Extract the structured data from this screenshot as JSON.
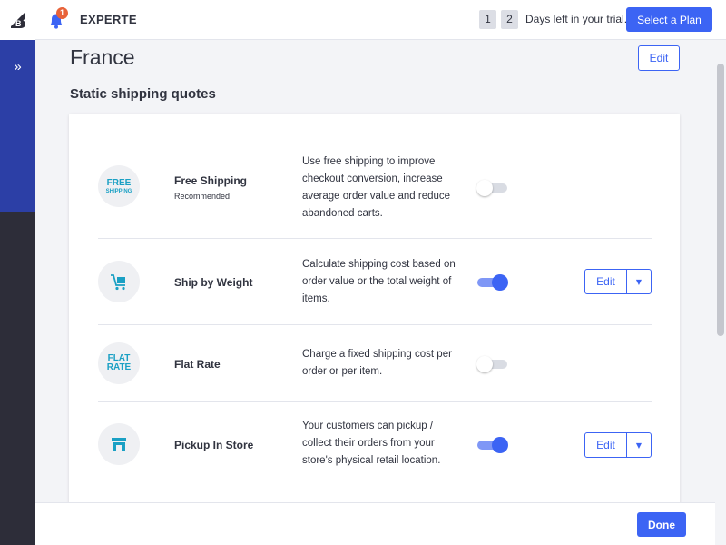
{
  "header": {
    "store_name": "EXPERTE",
    "notification_count": "1",
    "trial_digits": [
      "1",
      "2"
    ],
    "trial_text": "Days left in your trial.",
    "plan_button": "Select a Plan"
  },
  "page": {
    "country": "France",
    "edit_label": "Edit",
    "section_title": "Static shipping quotes"
  },
  "methods": [
    {
      "icon_text": [
        "FREE",
        "SHIPPING"
      ],
      "name": "Free Shipping",
      "sub": "Recommended",
      "description": "Use free shipping to improve checkout conversion, increase average order value and reduce abandoned carts.",
      "enabled": false
    },
    {
      "icon": "cart-icon",
      "name": "Ship by Weight",
      "description": "Calculate shipping cost based on order value or the total weight of items.",
      "enabled": true,
      "edit_label": "Edit"
    },
    {
      "icon_text": [
        "FLAT",
        "RATE"
      ],
      "name": "Flat Rate",
      "description": "Charge a fixed shipping cost per order or per item.",
      "enabled": false
    },
    {
      "icon": "store-icon",
      "name": "Pickup In Store",
      "description": "Your customers can pickup / collect their orders from your store's physical retail location.",
      "enabled": true,
      "edit_label": "Edit"
    }
  ],
  "footer": {
    "done_label": "Done"
  },
  "colors": {
    "accent": "#3c64f4",
    "sidebar_blue": "#2c3fa6",
    "sidebar_dark": "#2d2d39",
    "icon_teal": "#1aa0c4",
    "badge": "#e8633a"
  }
}
